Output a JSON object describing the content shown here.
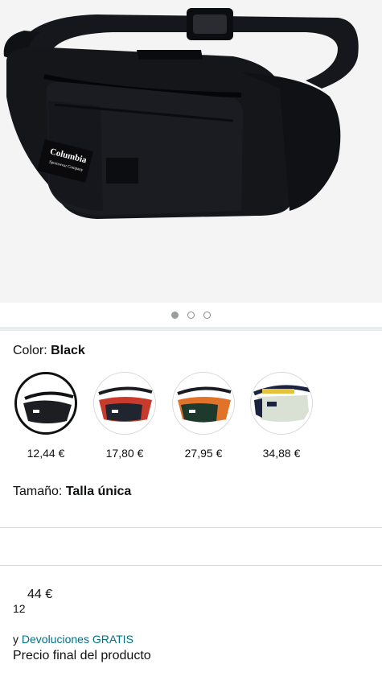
{
  "gallery": {
    "image_count": 3,
    "active_index": 0,
    "logo_text_main": "Columbia",
    "logo_text_sub": "Sportswear Company"
  },
  "color": {
    "label": "Color: ",
    "value": "Black"
  },
  "swatches": [
    {
      "price": "12,44 €",
      "selected": true,
      "main": "#1c1e24",
      "accent": "#111215"
    },
    {
      "price": "17,80 €",
      "selected": false,
      "main": "#1f2630",
      "accent": "#c83a2c"
    },
    {
      "price": "27,95 €",
      "selected": false,
      "main": "#1e3a2c",
      "accent": "#e0722a"
    },
    {
      "price": "34,88 €",
      "selected": false,
      "main": "#d9e0d4",
      "accent": "#1b2340"
    }
  ],
  "size": {
    "label": "Tamaño: ",
    "value": "Talla única"
  },
  "price": {
    "main": "44 €",
    "cents": "12"
  },
  "returns": {
    "prefix": "y ",
    "link": "Devoluciones GRATIS"
  },
  "final_price_label": "Precio final del producto",
  "colors": {
    "link": "#007185",
    "divider": "#d5d9d9",
    "hero_bg": "#f4f4f4"
  }
}
